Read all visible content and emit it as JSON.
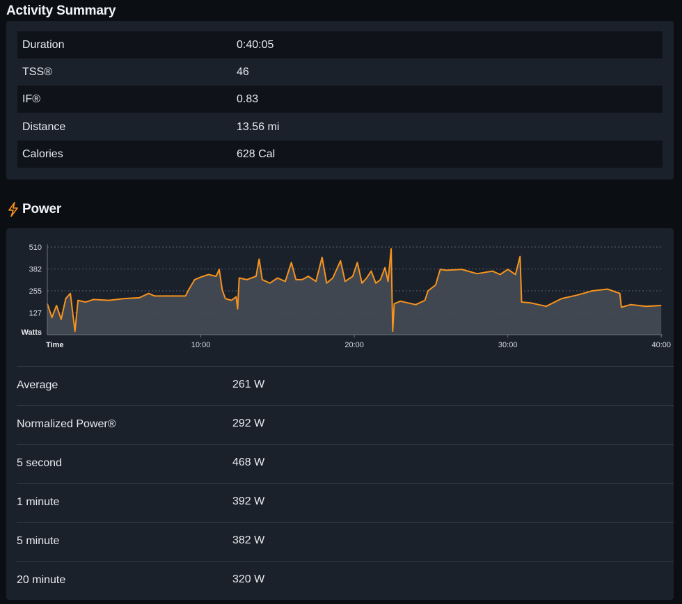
{
  "summary": {
    "title": "Activity Summary",
    "rows": [
      {
        "label": "Duration",
        "value": "0:40:05"
      },
      {
        "label": "TSS®",
        "value": "46"
      },
      {
        "label": "IF®",
        "value": "0.83"
      },
      {
        "label": "Distance",
        "value": "13.56 mi"
      },
      {
        "label": "Calories",
        "value": "628 Cal"
      }
    ]
  },
  "power": {
    "title": "Power",
    "icon": "lightning-bolt-icon",
    "stats": [
      {
        "label": "Average",
        "value": "261 W"
      },
      {
        "label": "Normalized Power®",
        "value": "292 W"
      },
      {
        "label": "5 second",
        "value": "468 W"
      },
      {
        "label": "1 minute",
        "value": "392 W"
      },
      {
        "label": "5 minute",
        "value": "382 W"
      },
      {
        "label": "20 minute",
        "value": "320 W"
      }
    ]
  },
  "colors": {
    "accent": "#f7931e",
    "card": "#1a212b",
    "page": "#0b0e13",
    "fill": "#454b55"
  },
  "chart_data": {
    "type": "area",
    "xlabel": "Time",
    "ylabel": "Watts",
    "x_unit": "minutes",
    "x_ticks": [
      {
        "value": 10,
        "label": "10:00"
      },
      {
        "value": 20,
        "label": "20:00"
      },
      {
        "value": 30,
        "label": "30:00"
      },
      {
        "value": 40,
        "label": "40:00"
      }
    ],
    "y_ticks": [
      127,
      255,
      382,
      510
    ],
    "xlim": [
      0,
      40.08
    ],
    "ylim": [
      0,
      510
    ],
    "grid": true,
    "series": [
      {
        "points": [
          [
            0,
            180
          ],
          [
            0.3,
            100
          ],
          [
            0.6,
            170
          ],
          [
            0.9,
            90
          ],
          [
            1.2,
            210
          ],
          [
            1.5,
            240
          ],
          [
            1.8,
            20
          ],
          [
            2.0,
            200
          ],
          [
            2.5,
            190
          ],
          [
            3,
            205
          ],
          [
            4,
            200
          ],
          [
            5,
            210
          ],
          [
            6,
            215
          ],
          [
            6.6,
            240
          ],
          [
            7,
            225
          ],
          [
            8,
            225
          ],
          [
            9,
            225
          ],
          [
            9.2,
            260
          ],
          [
            9.6,
            320
          ],
          [
            10,
            335
          ],
          [
            10.5,
            350
          ],
          [
            11,
            340
          ],
          [
            11.2,
            380
          ],
          [
            11.4,
            260
          ],
          [
            11.6,
            210
          ],
          [
            12,
            200
          ],
          [
            12.3,
            220
          ],
          [
            12.4,
            150
          ],
          [
            12.5,
            330
          ],
          [
            13,
            320
          ],
          [
            13.6,
            340
          ],
          [
            13.8,
            440
          ],
          [
            14,
            320
          ],
          [
            14.5,
            300
          ],
          [
            15,
            330
          ],
          [
            15.5,
            310
          ],
          [
            15.9,
            420
          ],
          [
            16.2,
            320
          ],
          [
            16.6,
            320
          ],
          [
            17,
            340
          ],
          [
            17.5,
            310
          ],
          [
            17.9,
            450
          ],
          [
            18.2,
            300
          ],
          [
            18.6,
            330
          ],
          [
            19.1,
            430
          ],
          [
            19.4,
            310
          ],
          [
            19.9,
            340
          ],
          [
            20.2,
            420
          ],
          [
            20.5,
            300
          ],
          [
            20.8,
            330
          ],
          [
            21.1,
            370
          ],
          [
            21.4,
            300
          ],
          [
            21.7,
            320
          ],
          [
            22.0,
            390
          ],
          [
            22.2,
            310
          ],
          [
            22.4,
            500
          ],
          [
            22.5,
            20
          ],
          [
            22.6,
            180
          ],
          [
            23,
            195
          ],
          [
            24,
            175
          ],
          [
            24.6,
            200
          ],
          [
            24.8,
            255
          ],
          [
            25.3,
            290
          ],
          [
            25.6,
            380
          ],
          [
            26,
            375
          ],
          [
            27,
            380
          ],
          [
            28,
            355
          ],
          [
            29,
            370
          ],
          [
            29.5,
            350
          ],
          [
            30,
            380
          ],
          [
            30.5,
            350
          ],
          [
            30.8,
            455
          ],
          [
            30.9,
            190
          ],
          [
            31.5,
            185
          ],
          [
            32.5,
            165
          ],
          [
            33.5,
            210
          ],
          [
            34.5,
            230
          ],
          [
            35.5,
            255
          ],
          [
            36.5,
            265
          ],
          [
            37.3,
            240
          ],
          [
            37.4,
            160
          ],
          [
            38,
            175
          ],
          [
            39,
            165
          ],
          [
            40,
            170
          ]
        ]
      }
    ]
  }
}
